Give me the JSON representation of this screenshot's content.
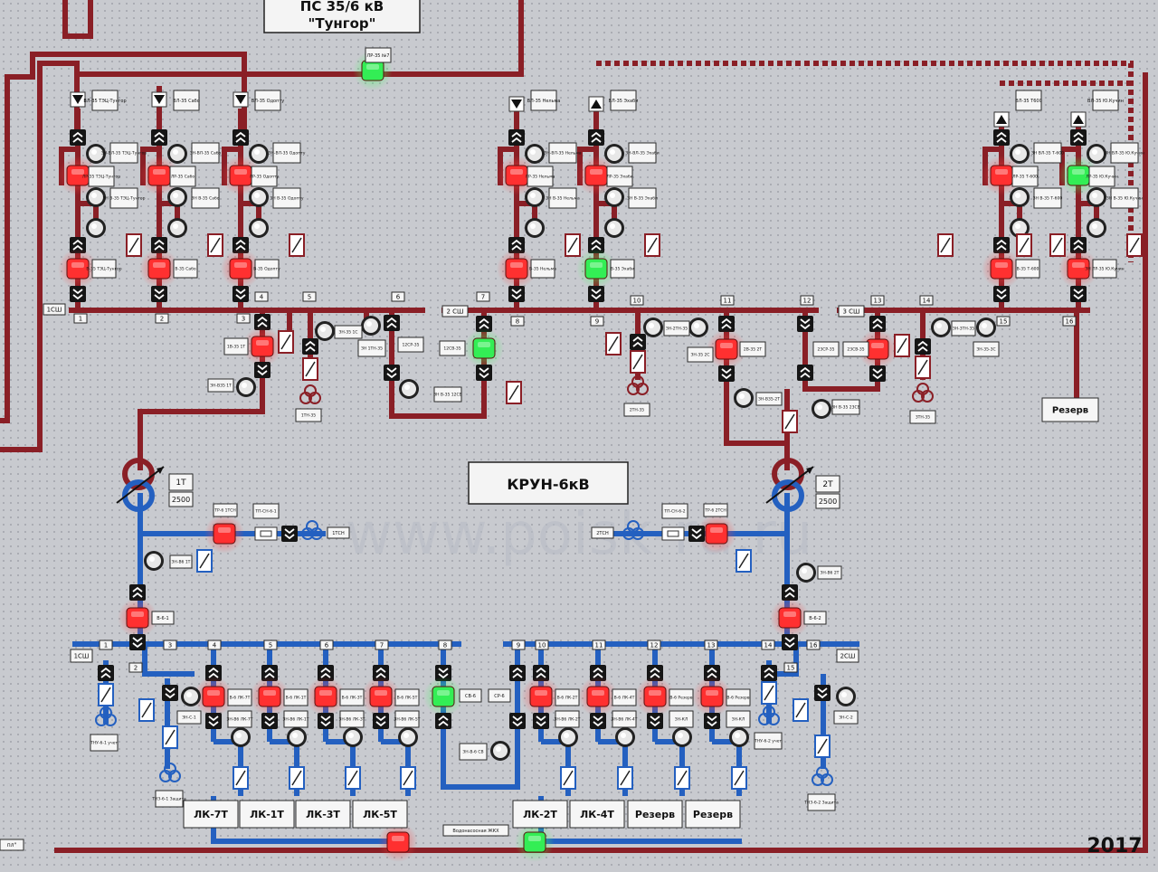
{
  "title": {
    "line1": "ПС 35/6 кВ",
    "line2": "\"Тунгор\""
  },
  "center_label": "КРУН-6кВ",
  "year": "2017",
  "watermark": "www.poisk-ru.ru",
  "colors": {
    "bus35": "#8a1f26",
    "bus6": "#2460c0",
    "lamp_red": "#ff3030",
    "lamp_green": "#33ee55",
    "panel": "#c8cacf",
    "dots": "#9fa3aa"
  },
  "top_bus_tag": "ЛР-35 №7",
  "buses": {
    "b1": {
      "label": "1СШ"
    },
    "b2": {
      "label": "2 СШ"
    },
    "b3": {
      "label": "3 СШ"
    },
    "k1": {
      "label": "1СШ"
    },
    "k2": {
      "label": "2СШ"
    }
  },
  "lines35": [
    {
      "name": "ВЛ-35 ТЭЦ-Тунгор",
      "ls": "ЛР-35 ТЭЦ-Тунгор",
      "zn_top": "ЗН-ВЛ-35 ТЭЦ-Тунгор",
      "zn_mid": "ЗН В-35 ТЭЦ-Тунгор",
      "brk": "В-35 ТЭЦ-Тунгор",
      "brk_state": "red",
      "ls_state": "red"
    },
    {
      "name": "ВЛ-35 Сабо",
      "ls": "ЛР-35 Сабо",
      "zn_top": "ЗН-ВЛ-35 Сабо",
      "zn_mid": "ЗН В-35 Сабо",
      "brk": "В-35 Сабо",
      "brk_state": "red",
      "ls_state": "red"
    },
    {
      "name": "ВЛ-35 Одопту",
      "ls": "ЛР-35 Одопту",
      "zn_top": "ЗН-ВЛ-35 Одопту",
      "zn_mid": "ЗН В-35 Одопту",
      "brk": "В-35 Одопту",
      "brk_state": "red",
      "ls_state": "red"
    },
    {
      "name": "ВЛ-35 Нельма",
      "ls": "ЛР-35 Нельма",
      "zn_top": "ЗН-ВЛ-35 Нельма",
      "zn_mid": "ЗН В-35 Нельма",
      "brk": "В-35 Нельма",
      "brk_state": "red",
      "ls_state": "red"
    },
    {
      "name": "ВЛ-35 Эхаби",
      "ls": "ЛР-35 Эхаби",
      "zn_top": "ЗН-ВЛ-35 Эхаби",
      "zn_mid": "ЗН В-35 Эхаби",
      "brk": "В-35 Эхаби",
      "brk_state": "green",
      "ls_state": "red"
    },
    {
      "name": "ВЛ-35 Т600",
      "ls": "ЛР-35 Т-600",
      "zn_top": "ЗН ВЛ-35 Т-600",
      "zn_mid": "ЗН В-35 Т-600",
      "brk": "В-35 Т-600",
      "brk_state": "red",
      "ls_state": "red"
    },
    {
      "name": "ВЛ-35 Ю.Кучин",
      "ls": "ЛР-35 Ю.Кучин",
      "zn_top": "ЗН ВЛ-35 Ю.Кучин",
      "zn_mid": "ЗН В-35 Ю.Кучин",
      "brk": "ЗН ЛР-35 Ю.Кучин",
      "brk_state": "red",
      "ls_state": "green"
    }
  ],
  "cells35": [
    "1",
    "2",
    "3",
    "4",
    "5",
    "6",
    "7",
    "8",
    "9",
    "10",
    "11",
    "12",
    "13",
    "14",
    "15",
    "16"
  ],
  "tags35": {
    "v35_1t": "1В-35 1Т",
    "zn_v35_1t": "ЗН-В35 1Т",
    "zn_1tn": "ЗН 1ТН-35",
    "zn_35_1c": "ЗН-35 1С",
    "tn1": "1ТН-35",
    "sr12": "12СР-35",
    "sv12": "12СВ-35",
    "zn_v35_12sv": "ЗН В-35 12СВ",
    "zn_2tn": "ЗН-2ТН-35",
    "zn_35_2c": "ЗН-35 2С",
    "v35_2t": "2В-35 2Т",
    "tn2": "2ТН-35",
    "zn_v35_2t": "ЗН-В35-2Т",
    "sr23": "23СР-35",
    "sv23": "23СВ-35",
    "zn_v35_23sv": "ЗН В-35 23СВ",
    "zn_3tn": "ЗН-3ТН-35",
    "zn_35_3c": "ЗН-35-3С",
    "tn3": "3ТН-35",
    "reserve": "Резерв"
  },
  "transformers": [
    {
      "name": "1Т",
      "power": "2500"
    },
    {
      "name": "2Т",
      "power": "2500"
    }
  ],
  "tsn": {
    "tr1": "ТР-6 1ТСН",
    "tp1": "ТП-СН-6-1",
    "tsn1": "1ТСН",
    "zn_v6_1t": "ЗН-В6 1Т",
    "v6_1": "В-6-1",
    "tr2": "ТР-6 2ТСН",
    "tp2": "ТП-СН-6-2",
    "tsn2": "2ТСН",
    "zn_v6_2t": "ЗН-В6 2Т",
    "v6_2": "В-6-2"
  },
  "cells6": [
    "1",
    "2",
    "3",
    "4",
    "5",
    "6",
    "7",
    "8",
    "9",
    "10",
    "11",
    "12",
    "13",
    "14",
    "15",
    "16"
  ],
  "feeders6": [
    {
      "brk": "В-6 ЛК-7Т",
      "zn": "ЗН-В6 ЛК-7Т",
      "name": "ЛК-7Т",
      "state": "red"
    },
    {
      "brk": "В-6 ЛК-1Т",
      "zn": "ЗН-В6 ЛК-1Т",
      "name": "ЛК-1Т",
      "state": "red"
    },
    {
      "brk": "В-6 ЛК-3Т",
      "zn": "ЗН-В6 ЛК-3Т",
      "name": "ЛК-3Т",
      "state": "red"
    },
    {
      "brk": "В-6 ЛК-5Т",
      "zn": "ЗН-В6 ЛК-5Т",
      "name": "ЛК-5Т",
      "state": "red"
    },
    {
      "brk": "В-6 ЛК-2Т",
      "zn": "ЗН-В6 ЛК-2Т",
      "name": "ЛК-2Т",
      "state": "red"
    },
    {
      "brk": "В-6 ЛК-4Т",
      "zn": "ЗН-В6 ЛК-4Т",
      "name": "ЛК-4Т",
      "state": "red"
    },
    {
      "brk": "В-6 Резерв",
      "zn": "ЗН-КЛ",
      "name": "Резерв",
      "state": "red"
    },
    {
      "brk": "В-6 Резерв",
      "zn": "ЗН-КЛ",
      "name": "Резерв",
      "state": "red"
    }
  ],
  "tags6": {
    "sv6": "СВ-6",
    "sr6": "СР-6",
    "zn_v6_sv": "ЗН-В-6 СВ",
    "zn_c1": "ЗН-С-1",
    "zn_c2": "ЗН-С-2",
    "tnu1": "ТНУ-6-1 учет",
    "tnu2": "ТНУ-6-2 учет",
    "tnz1": "ТНЗ-6-1 Защита",
    "tnz2": "ТНЗ-6-2 Защита",
    "vodo": "Водонасосная ЖКХ",
    "left_edge": "пл\""
  }
}
